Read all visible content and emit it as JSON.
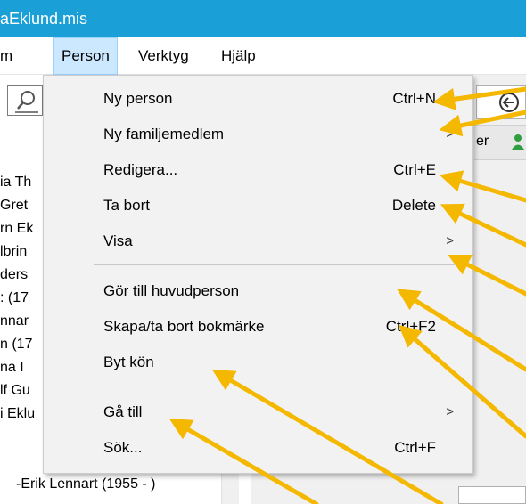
{
  "window": {
    "title": "aEklund.mis"
  },
  "menubar": {
    "items": [
      {
        "label": "m"
      },
      {
        "label": "Person"
      },
      {
        "label": "Verktyg"
      },
      {
        "label": "Hjälp"
      }
    ]
  },
  "tree": {
    "items": [
      {
        "label": "ia Th"
      },
      {
        "label": "Gret"
      },
      {
        "label": "rn Ek"
      },
      {
        "label": "lbrin"
      },
      {
        "label": "ders"
      },
      {
        "label": ": (17"
      },
      {
        "label": "nnar"
      },
      {
        "label": "n (17"
      },
      {
        "label": "na I"
      },
      {
        "label": "lf Gu"
      },
      {
        "label": "i Eklu"
      },
      {
        "label": "-Erik Lennart (1955 - )"
      }
    ]
  },
  "right_panel": {
    "tab_fragment": "er"
  },
  "person_menu": {
    "items": [
      {
        "label": "Ny person",
        "shortcut": "Ctrl+N",
        "submenu": false
      },
      {
        "label": "Ny familjemedlem",
        "shortcut": "",
        "submenu": true
      },
      {
        "label": "Redigera...",
        "shortcut": "Ctrl+E",
        "submenu": false
      },
      {
        "label": "Ta bort",
        "shortcut": "Delete",
        "submenu": false
      },
      {
        "label": "Visa",
        "shortcut": "",
        "submenu": true
      },
      {
        "label": "Gör till huvudperson",
        "shortcut": "",
        "submenu": false
      },
      {
        "label": "Skapa/ta bort bokmärke",
        "shortcut": "Ctrl+F2",
        "submenu": false
      },
      {
        "label": "Byt kön",
        "shortcut": "",
        "submenu": false
      },
      {
        "label": "Gå till",
        "shortcut": "",
        "submenu": true
      },
      {
        "label": "Sök...",
        "shortcut": "Ctrl+F",
        "submenu": false
      }
    ]
  },
  "icons": {
    "search": "search-icon",
    "back": "back-arrow-icon",
    "submenu": "chevron-right-icon",
    "person": "person-icon",
    "annotation": "annotation-arrow-icon"
  },
  "colors": {
    "titlebar": "#1a9fd6",
    "menu_active": "#cce8ff",
    "menu_bg": "#f2f2f2",
    "annotation": "#f5b800"
  }
}
